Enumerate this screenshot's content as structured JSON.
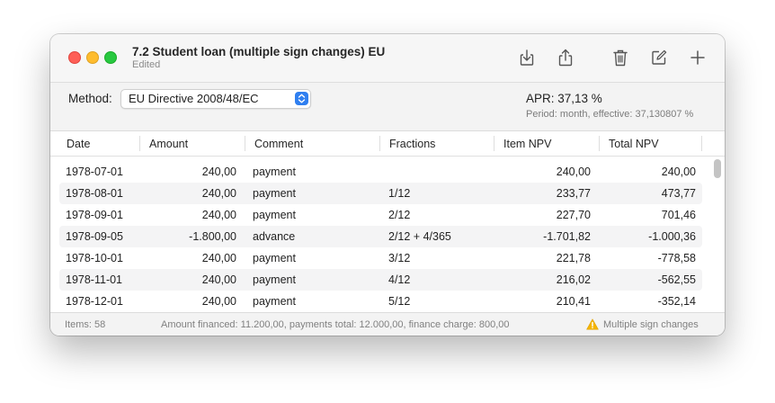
{
  "window": {
    "title": "7.2 Student loan (multiple sign changes) EU",
    "subtitle": "Edited"
  },
  "toolbar": {
    "buttons": [
      "download-icon",
      "share-icon",
      "trash-icon",
      "compose-icon",
      "plus-icon"
    ]
  },
  "method": {
    "label": "Method:",
    "value": "EU Directive 2008/48/EC"
  },
  "result": {
    "apr": "APR: 37,13 %",
    "period": "Period: month, effective: 37,130807 %"
  },
  "table": {
    "columns": [
      "Date",
      "Amount",
      "Comment",
      "Fractions",
      "Item NPV",
      "Total NPV"
    ],
    "rows": [
      {
        "date": "1978-07-01",
        "amount": "240,00",
        "comment": "payment",
        "fractions": "",
        "item_npv": "240,00",
        "total_npv": "240,00"
      },
      {
        "date": "1978-08-01",
        "amount": "240,00",
        "comment": "payment",
        "fractions": "1/12",
        "item_npv": "233,77",
        "total_npv": "473,77"
      },
      {
        "date": "1978-09-01",
        "amount": "240,00",
        "comment": "payment",
        "fractions": "2/12",
        "item_npv": "227,70",
        "total_npv": "701,46"
      },
      {
        "date": "1978-09-05",
        "amount": "-1.800,00",
        "comment": "advance",
        "fractions": "2/12 + 4/365",
        "item_npv": "-1.701,82",
        "total_npv": "-1.000,36"
      },
      {
        "date": "1978-10-01",
        "amount": "240,00",
        "comment": "payment",
        "fractions": "3/12",
        "item_npv": "221,78",
        "total_npv": "-778,58"
      },
      {
        "date": "1978-11-01",
        "amount": "240,00",
        "comment": "payment",
        "fractions": "4/12",
        "item_npv": "216,02",
        "total_npv": "-562,55"
      },
      {
        "date": "1978-12-01",
        "amount": "240,00",
        "comment": "payment",
        "fractions": "5/12",
        "item_npv": "210,41",
        "total_npv": "-352,14"
      }
    ]
  },
  "status": {
    "items": "Items: 58",
    "summary": "Amount financed: 11.200,00, payments total: 12.000,00, finance charge: 800,00",
    "warning": "Multiple sign changes"
  },
  "colors": {
    "accent": "#2f7ff0",
    "warning": "#f5b400",
    "close": "#fe5f57",
    "minimize": "#febc2e",
    "zoom": "#28c840"
  }
}
